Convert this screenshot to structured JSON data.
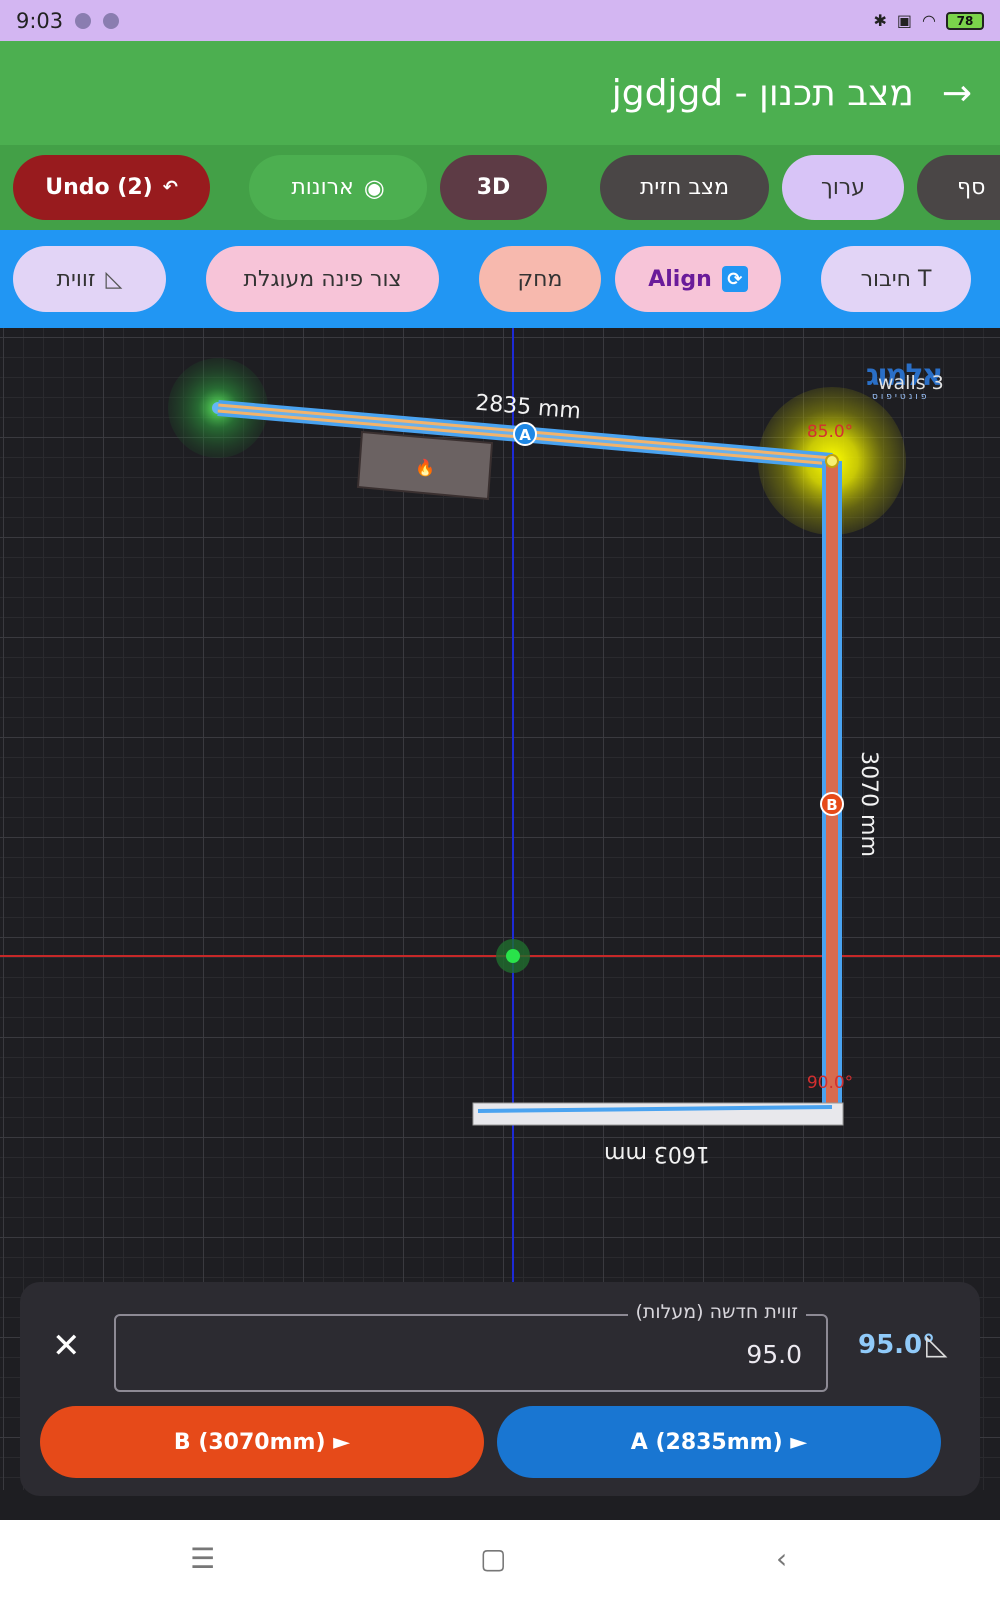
{
  "status_bar": {
    "time": "9:03",
    "battery": "78"
  },
  "app_bar": {
    "title": "מצב תכנון - jgdjgd"
  },
  "toolbar1": {
    "undo": "Undo (2)",
    "cabinets": "ארונות",
    "three_d": "3D",
    "view_mode": "מצב חזית",
    "edit": "ערוך",
    "more": "סף"
  },
  "toolbar2": {
    "angles": "זווית",
    "rounded_corner": "צור פינה מעוגלת",
    "delete": "מחק",
    "align": "Align",
    "t_join": "חיבור T"
  },
  "canvas": {
    "logo_text": "walls 3",
    "logo_brand": "אלמוג",
    "logo_sub": "פונטיפוס",
    "wall_a_length": "2835 mm",
    "wall_b_length": "3070 mm",
    "wall_c_length": "1603 mm",
    "label_a": "A",
    "label_b": "B",
    "angle_corner_top": "85.0°",
    "angle_corner_bottom": "90.0°",
    "cabinet_icon": "🔥"
  },
  "panel": {
    "field_label": "זווית חדשה (מעלות)",
    "field_value": "95.0",
    "angle_readout": "95.0°",
    "button_b": "B (3070mm) ►",
    "button_a": "A (2835mm) ►"
  },
  "colors": {
    "accent_green": "#4caf50",
    "accent_blue": "#2196f3",
    "wall_b_orange": "#e64a19",
    "button_a_blue": "#1976d2"
  },
  "icons": [
    "back-arrow-icon",
    "eye-icon",
    "undo-icon",
    "sync-icon",
    "triangle-ruler-icon",
    "close-icon",
    "menu-icon",
    "home-icon",
    "back-icon",
    "bluetooth-icon",
    "wifi-icon"
  ]
}
